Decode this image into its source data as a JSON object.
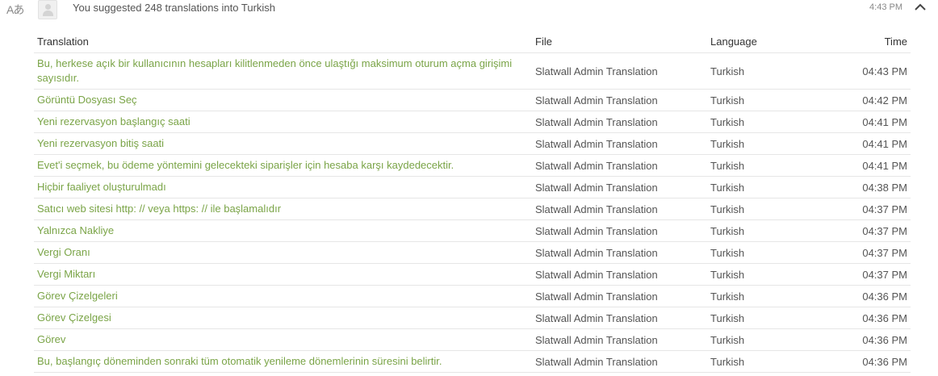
{
  "header": {
    "icon": "translate-icon",
    "icon_glyph": "Aあ",
    "summary": "You suggested 248 translations into Turkish",
    "time": "4:43 PM"
  },
  "table": {
    "columns": [
      "Translation",
      "File",
      "Language",
      "Time"
    ],
    "rows": [
      {
        "translation": "Bu, herkese açık bir kullanıcının hesapları kilitlenmeden önce ulaştığı maksimum oturum açma girişimi sayısıdır.",
        "file": "Slatwall Admin Translation",
        "language": "Turkish",
        "time": "04:43 PM"
      },
      {
        "translation": "Görüntü Dosyası Seç",
        "file": "Slatwall Admin Translation",
        "language": "Turkish",
        "time": "04:42 PM"
      },
      {
        "translation": "Yeni rezervasyon başlangıç saati",
        "file": "Slatwall Admin Translation",
        "language": "Turkish",
        "time": "04:41 PM"
      },
      {
        "translation": "Yeni rezervasyon bitiş saati",
        "file": "Slatwall Admin Translation",
        "language": "Turkish",
        "time": "04:41 PM"
      },
      {
        "translation": "Evet'i seçmek, bu ödeme yöntemini gelecekteki siparişler için hesaba karşı kaydedecektir.",
        "file": "Slatwall Admin Translation",
        "language": "Turkish",
        "time": "04:41 PM"
      },
      {
        "translation": "Hiçbir faaliyet oluşturulmadı",
        "file": "Slatwall Admin Translation",
        "language": "Turkish",
        "time": "04:38 PM"
      },
      {
        "translation": "Satıcı web sitesi http: // veya https: // ile başlamalıdır",
        "file": "Slatwall Admin Translation",
        "language": "Turkish",
        "time": "04:37 PM"
      },
      {
        "translation": "Yalnızca Nakliye",
        "file": "Slatwall Admin Translation",
        "language": "Turkish",
        "time": "04:37 PM"
      },
      {
        "translation": "Vergi Oranı",
        "file": "Slatwall Admin Translation",
        "language": "Turkish",
        "time": "04:37 PM"
      },
      {
        "translation": "Vergi Miktarı",
        "file": "Slatwall Admin Translation",
        "language": "Turkish",
        "time": "04:37 PM"
      },
      {
        "translation": "Görev Çizelgeleri",
        "file": "Slatwall Admin Translation",
        "language": "Turkish",
        "time": "04:36 PM"
      },
      {
        "translation": "Görev Çizelgesi",
        "file": "Slatwall Admin Translation",
        "language": "Turkish",
        "time": "04:36 PM"
      },
      {
        "translation": "Görev",
        "file": "Slatwall Admin Translation",
        "language": "Turkish",
        "time": "04:36 PM"
      },
      {
        "translation": "Bu, başlangıç döneminden sonraki tüm otomatik yenileme dönemlerinin süresini belirtir.",
        "file": "Slatwall Admin Translation",
        "language": "Turkish",
        "time": "04:36 PM"
      }
    ]
  },
  "colors": {
    "link": "#7aa447",
    "text": "#555555",
    "border": "#e6e6e6"
  }
}
